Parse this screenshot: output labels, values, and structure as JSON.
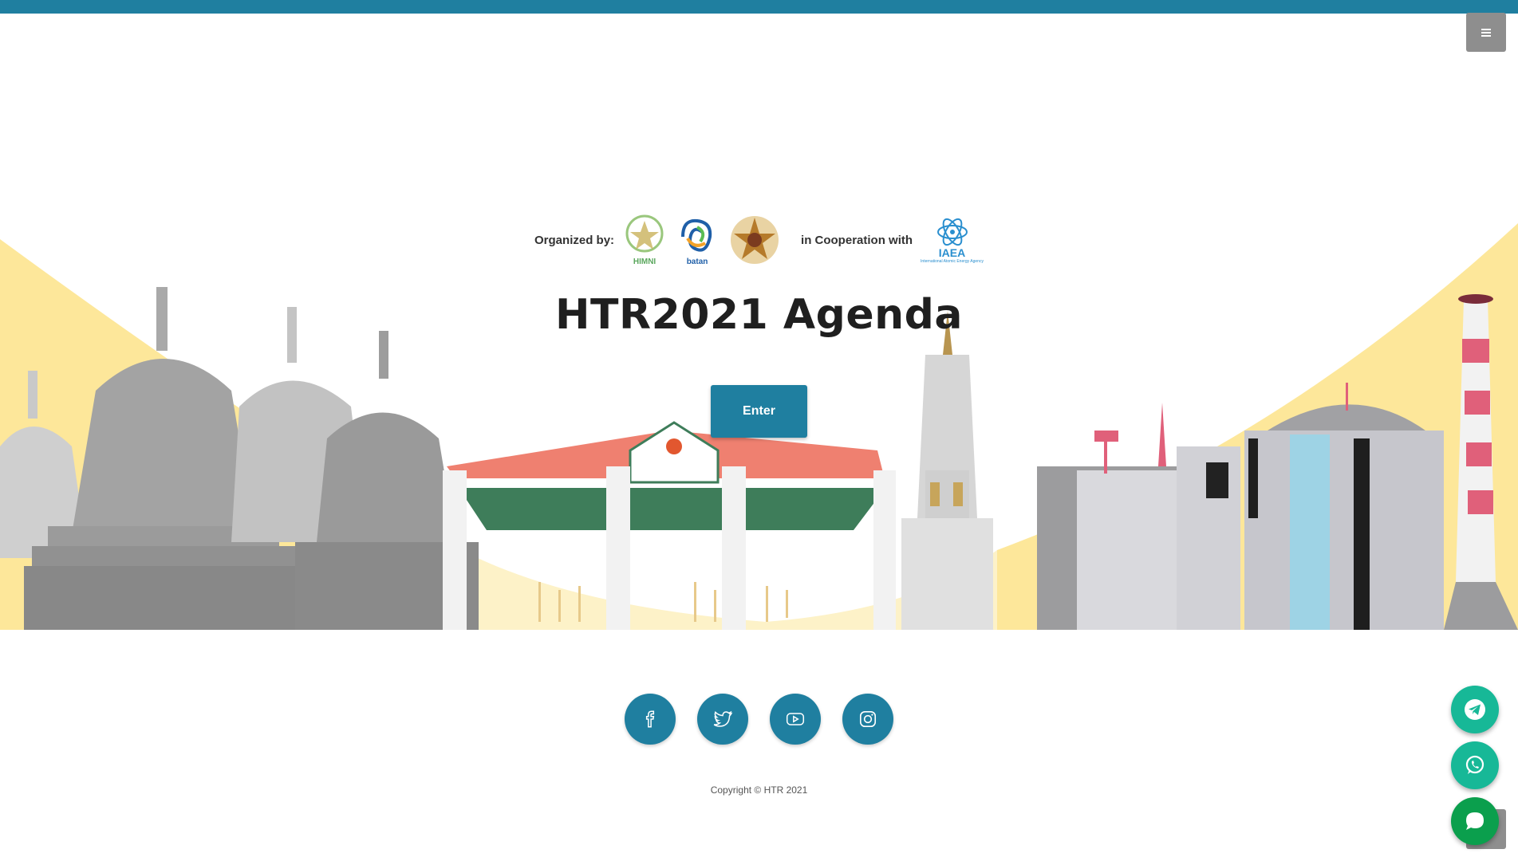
{
  "header": {
    "menu_icon": "hamburger-icon"
  },
  "organizers": {
    "organized_label": "Organized by:",
    "logos": [
      {
        "name": "himni-logo",
        "caption": "HIMNI"
      },
      {
        "name": "batan-logo",
        "caption": "batan"
      },
      {
        "name": "ugm-logo",
        "caption": ""
      }
    ],
    "cooperation_label": "in Cooperation with",
    "partner": {
      "name": "iaea-logo",
      "caption": "IAEA",
      "subcaption": "International Atomic Energy Agency"
    }
  },
  "main": {
    "title": "HTR2021 Agenda",
    "enter_label": "Enter"
  },
  "socials": [
    {
      "name": "facebook-icon"
    },
    {
      "name": "twitter-icon"
    },
    {
      "name": "youtube-icon"
    },
    {
      "name": "instagram-icon"
    }
  ],
  "footer": {
    "copyright": "Copyright © HTR 2021"
  },
  "floating": {
    "telegram_icon": "telegram-icon",
    "whatsapp_icon": "whatsapp-icon",
    "chat_icon": "chat-icon"
  },
  "colors": {
    "primary": "#1f7fa0",
    "accent_green": "#17b897",
    "hero_yellow": "#fde79a"
  }
}
